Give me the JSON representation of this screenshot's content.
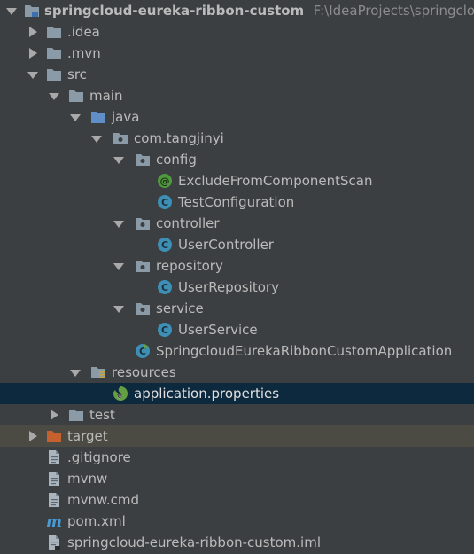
{
  "colors": {
    "background": "#3c3f41",
    "text": "#bbbbbb",
    "selected_row": "#0d293e",
    "highlighted_row": "#4b4b43",
    "folder": "#8a9aa6",
    "source_folder": "#5f8fc6",
    "excluded_folder": "#c4612f",
    "class_icon": "#3d8fb5",
    "annotation_icon": "#4f9a3d",
    "spring_icon": "#62a043"
  },
  "project_tree": {
    "root": {
      "name": "springcloud-eureka-ribbon-custom",
      "path": "F:\\IdeaProjects\\springcloud-"
    },
    "items": {
      "idea": ".idea",
      "mvn": ".mvn",
      "src": "src",
      "main": "main",
      "java": "java",
      "package": "com.tangjinyi",
      "config": "config",
      "exclude_annotation": "ExcludeFromComponentScan",
      "test_configuration": "TestConfiguration",
      "controller": "controller",
      "user_controller": "UserController",
      "repository": "repository",
      "user_repository": "UserRepository",
      "service": "service",
      "user_service": "UserService",
      "application_class": "SpringcloudEurekaRibbonCustomApplication",
      "resources": "resources",
      "application_properties": "application.properties",
      "test": "test",
      "target": "target",
      "gitignore": ".gitignore",
      "mvnw": "mvnw",
      "mvnw_cmd": "mvnw.cmd",
      "pom": "pom.xml",
      "iml": "springcloud-eureka-ribbon-custom.iml"
    }
  }
}
